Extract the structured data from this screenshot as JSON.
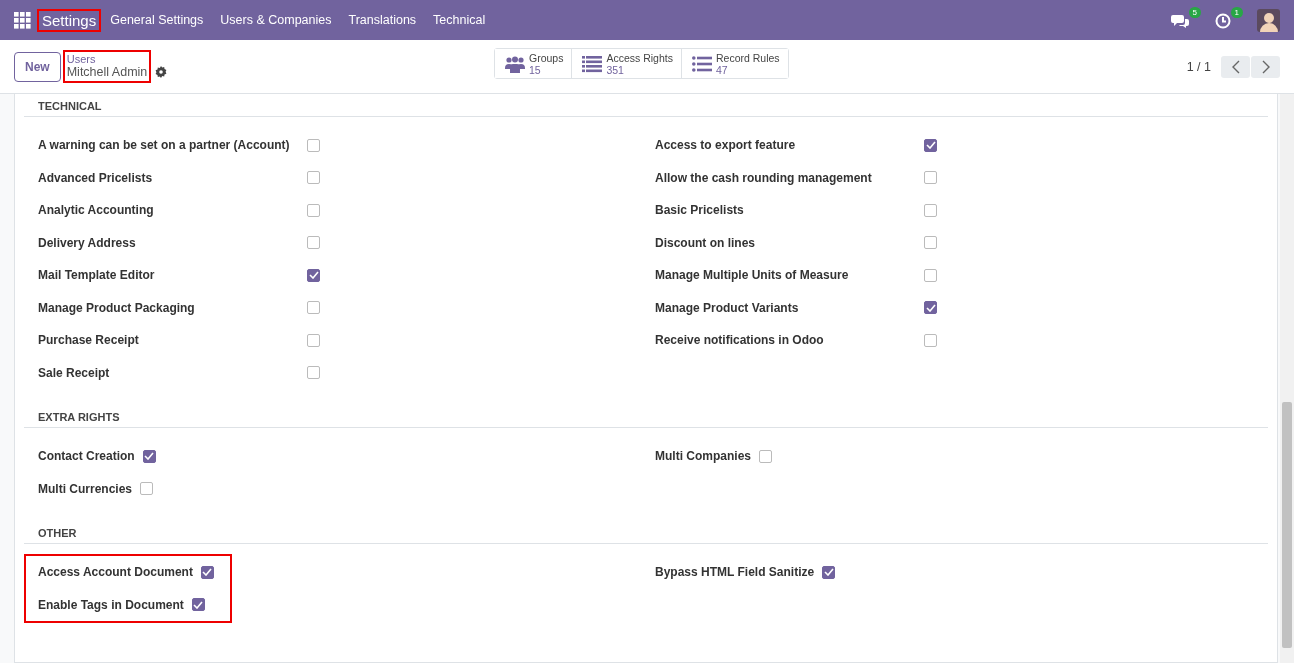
{
  "navbar": {
    "brand": {
      "label": "Settings",
      "highlighted": true
    },
    "menu": [
      "General Settings",
      "Users & Companies",
      "Translations",
      "Technical"
    ],
    "messages_count": "5",
    "activities_count": "1"
  },
  "control_panel": {
    "new_button": "New",
    "breadcrumb": {
      "parent": "Users",
      "current": "Mitchell Admin",
      "highlighted": true
    },
    "stat_buttons": [
      {
        "kind": "groups",
        "label": "Groups",
        "value": "15"
      },
      {
        "kind": "list",
        "label": "Access Rights",
        "value": "351"
      },
      {
        "kind": "bullets",
        "label": "Record Rules",
        "value": "47"
      }
    ],
    "pager": "1 / 1"
  },
  "sections": [
    {
      "title": "TECHNICAL",
      "kind": "aligned",
      "columns": [
        {
          "highlighted": false,
          "items": [
            {
              "label": "A warning can be set on a partner (Account)",
              "checked": false
            },
            {
              "label": "Advanced Pricelists",
              "checked": false
            },
            {
              "label": "Analytic Accounting",
              "checked": false
            },
            {
              "label": "Delivery Address",
              "checked": false
            },
            {
              "label": "Mail Template Editor",
              "checked": true
            },
            {
              "label": "Manage Product Packaging",
              "checked": false
            },
            {
              "label": "Purchase Receipt",
              "checked": false
            },
            {
              "label": "Sale Receipt",
              "checked": false
            }
          ]
        },
        {
          "highlighted": false,
          "items": [
            {
              "label": "Access to export feature",
              "checked": true
            },
            {
              "label": "Allow the cash rounding management",
              "checked": false
            },
            {
              "label": "Basic Pricelists",
              "checked": false
            },
            {
              "label": "Discount on lines",
              "checked": false
            },
            {
              "label": "Manage Multiple Units of Measure",
              "checked": false
            },
            {
              "label": "Manage Product Variants",
              "checked": true
            },
            {
              "label": "Receive notifications in Odoo",
              "checked": false
            }
          ]
        }
      ]
    },
    {
      "title": "EXTRA RIGHTS",
      "kind": "inline",
      "columns": [
        {
          "highlighted": false,
          "items": [
            {
              "label": "Contact Creation",
              "checked": true
            },
            {
              "label": "Multi Currencies",
              "checked": false
            }
          ]
        },
        {
          "highlighted": false,
          "items": [
            {
              "label": "Multi Companies",
              "checked": false
            }
          ]
        }
      ]
    },
    {
      "title": "OTHER",
      "kind": "inline",
      "columns": [
        {
          "highlighted": true,
          "items": [
            {
              "label": "Access Account Document",
              "checked": true
            },
            {
              "label": "Enable Tags in Document",
              "checked": true
            }
          ]
        },
        {
          "highlighted": false,
          "items": [
            {
              "label": "Bypass HTML Field Sanitize",
              "checked": true
            }
          ]
        }
      ]
    }
  ]
}
